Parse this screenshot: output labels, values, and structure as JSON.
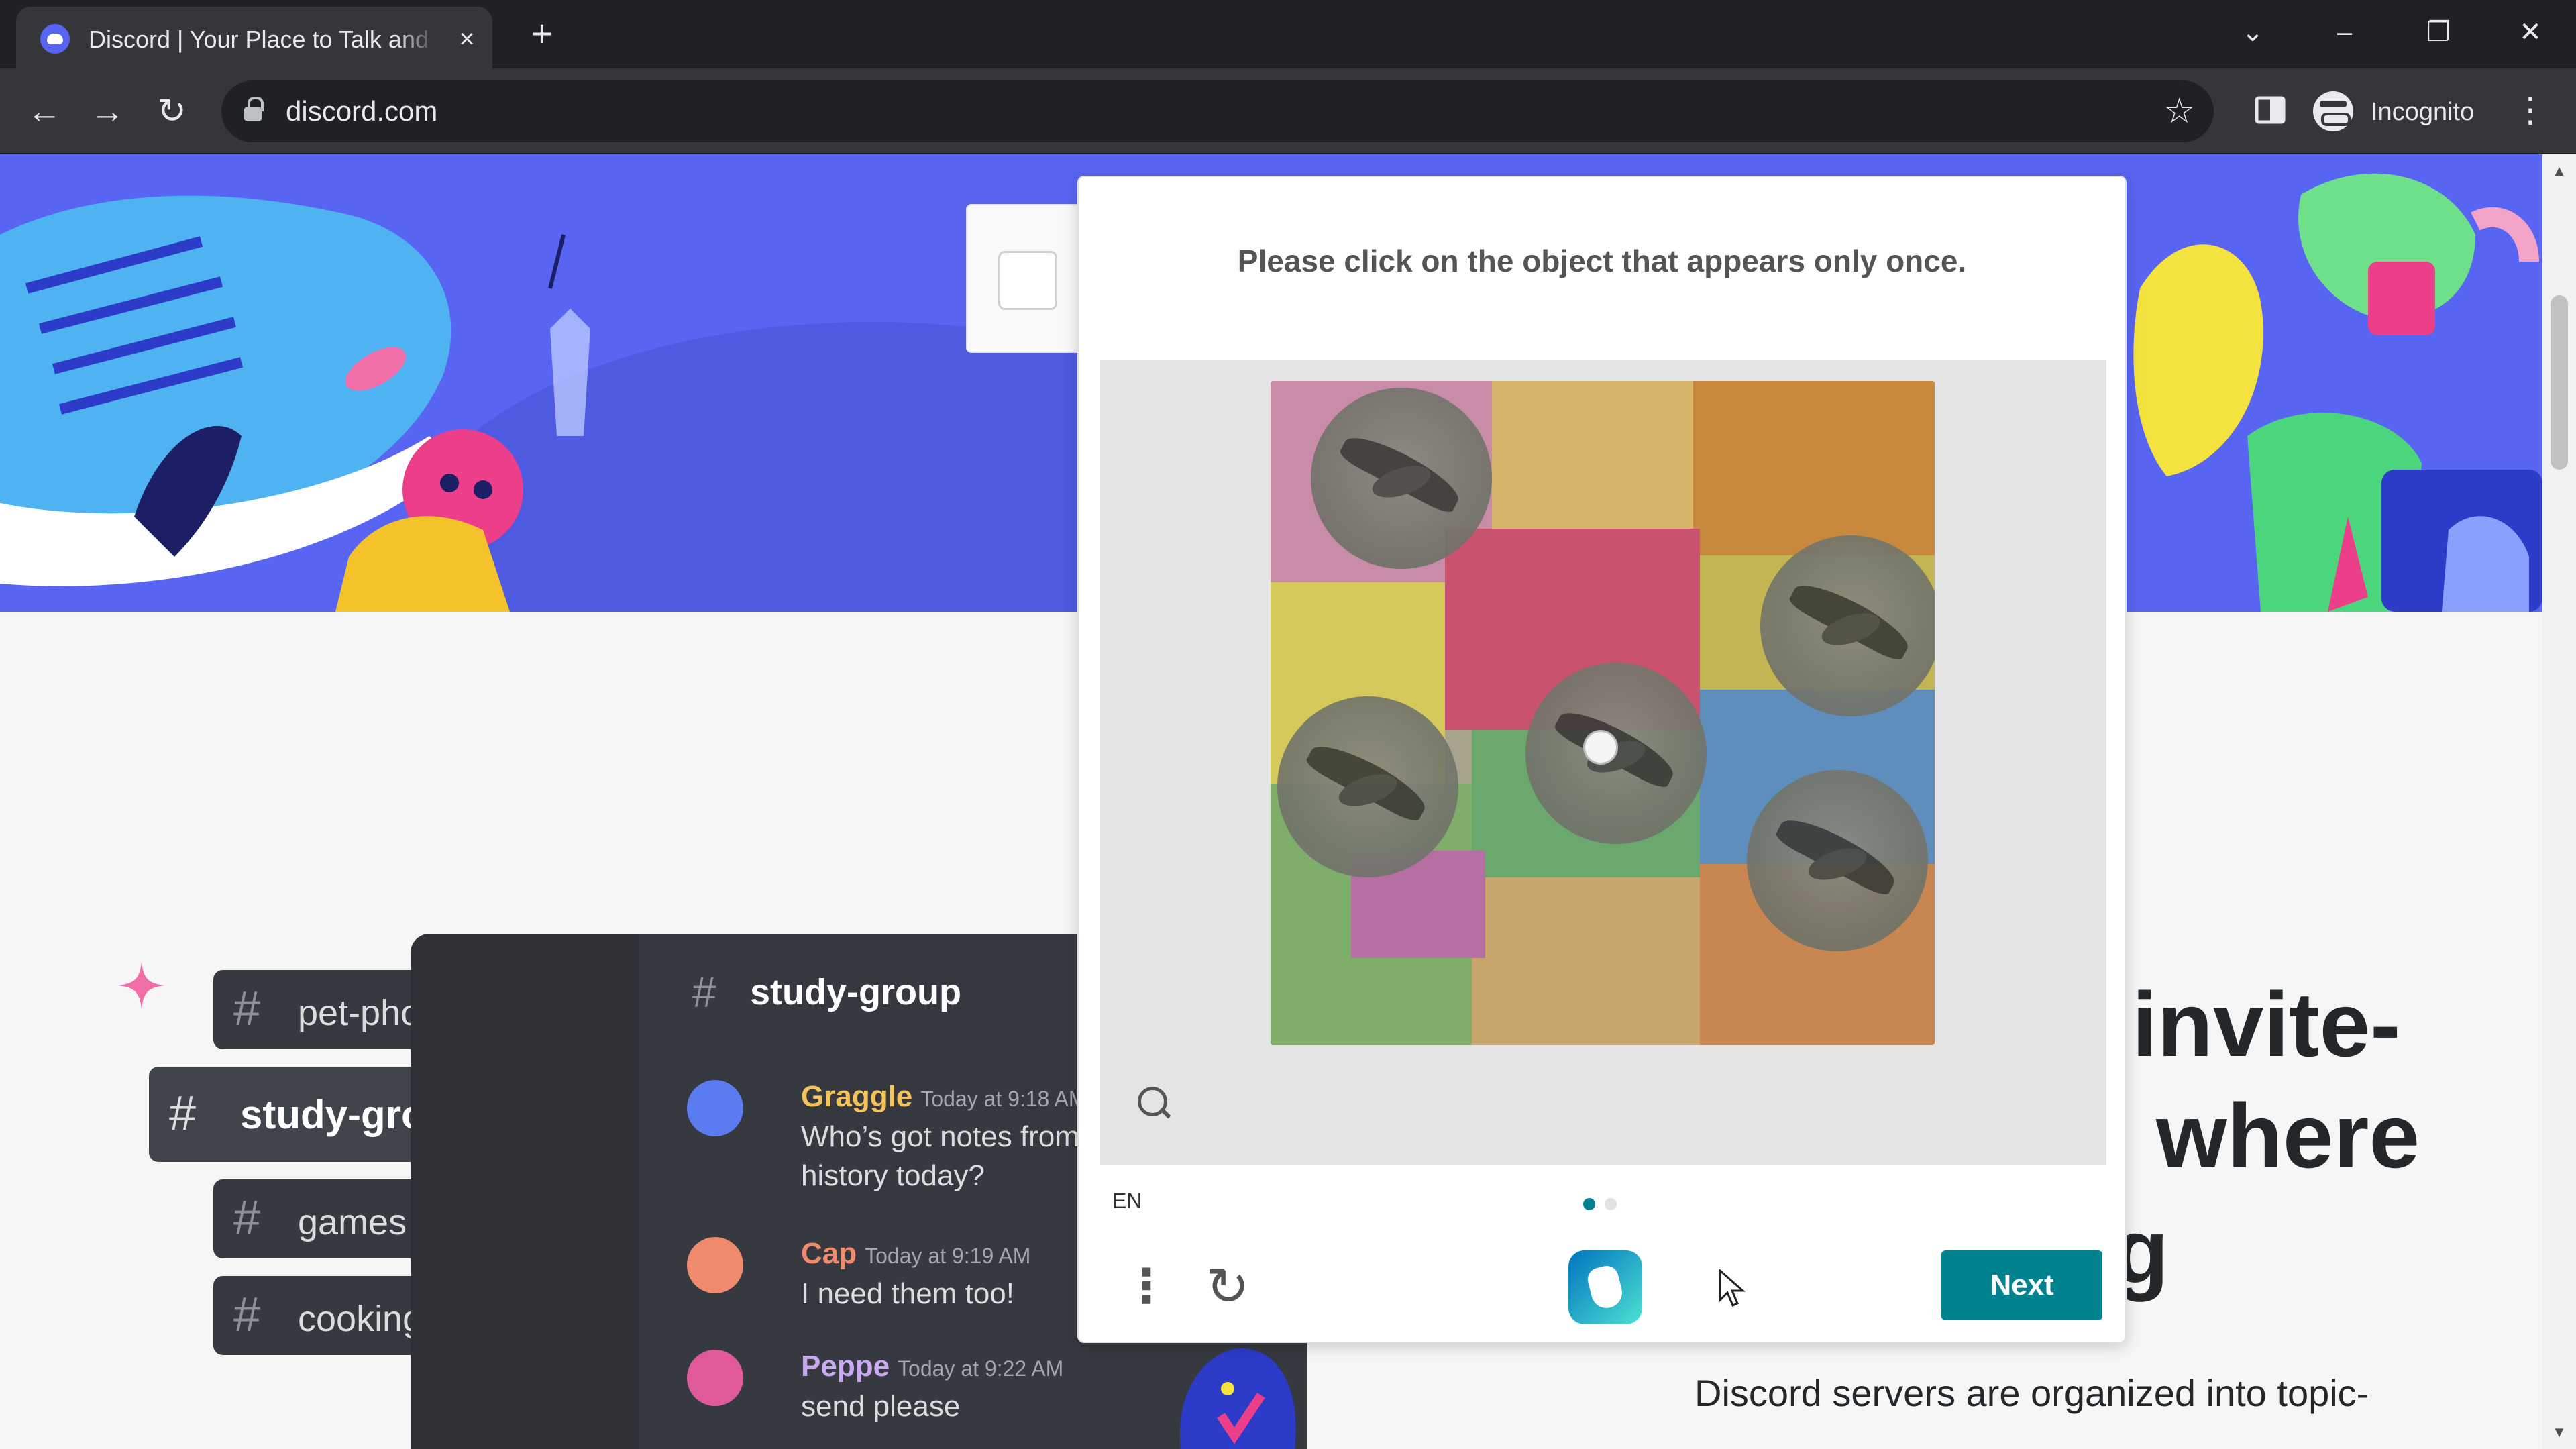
{
  "browser": {
    "tab_title": "Discord | Your Place to Talk and Hang Out",
    "url": "discord.com",
    "profile_label": "Incognito",
    "icons": {
      "favicon": "discord-icon",
      "close": "close-icon",
      "new_tab": "plus-icon",
      "back": "back-arrow-icon",
      "forward": "forward-arrow-icon",
      "reload": "reload-icon",
      "lock": "lock-icon",
      "bookmark": "star-icon",
      "side_panel": "side-panel-icon",
      "menu": "kebab-menu-icon"
    }
  },
  "page": {
    "channels": [
      {
        "label": "pet-photos",
        "active": false
      },
      {
        "label": "study-group",
        "active": true
      },
      {
        "label": "games",
        "active": false
      },
      {
        "label": "cooking",
        "active": false
      }
    ],
    "chat": {
      "channel": "study-group",
      "messages": [
        {
          "author": "Graggle",
          "time": "Today at 9:18 AM",
          "text_lines": [
            "Who’s got notes from",
            "history today?"
          ],
          "color": "#f4c45a"
        },
        {
          "author": "Cap",
          "time": "Today at 9:19 AM",
          "text_lines": [
            "I need them too!"
          ],
          "color": "#f08a6c"
        },
        {
          "author": "Peppe",
          "time": "Today at 9:22 AM",
          "text_lines": [
            "send please"
          ],
          "color": "#c9a9f2"
        }
      ]
    },
    "headline_lines": [
      "invite-",
      "where",
      "g"
    ],
    "body_copy": "Discord servers are organized into topic-"
  },
  "captcha": {
    "prompt": "Please click on the object that appears only once.",
    "language": "EN",
    "next_label": "Next",
    "page_index": 1,
    "page_count": 2,
    "icons": {
      "zoom": "search-icon",
      "menu": "kebab-menu-icon",
      "refresh": "refresh-icon",
      "logo": "hcaptcha-logo-icon"
    },
    "colors": {
      "accent": "#00838f"
    }
  }
}
